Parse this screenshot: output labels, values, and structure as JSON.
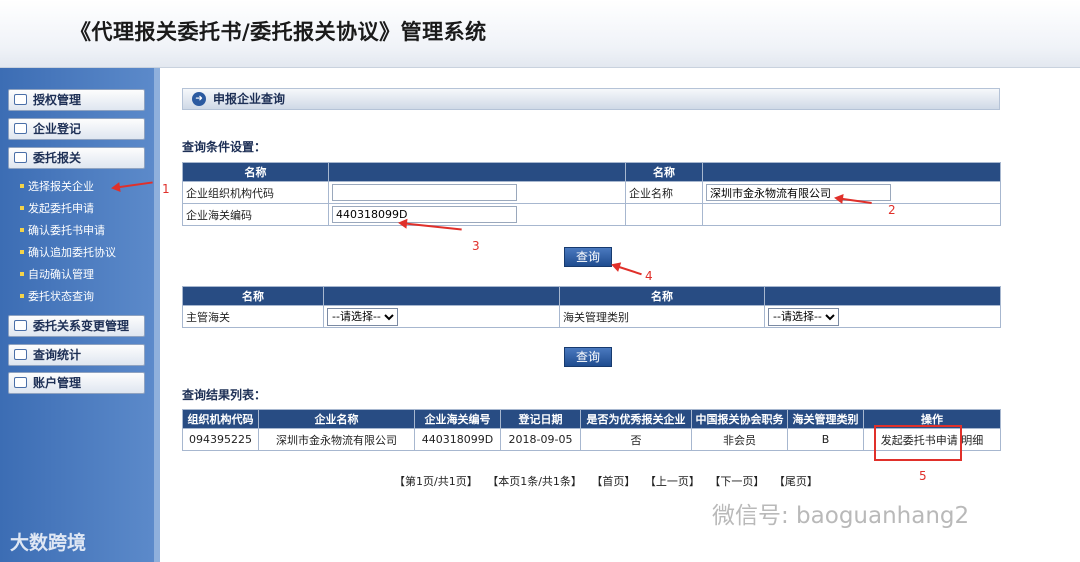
{
  "app_title": "《代理报关委托书/委托报关协议》管理系统",
  "sidebar": {
    "menus": [
      {
        "label": "授权管理"
      },
      {
        "label": "企业登记"
      },
      {
        "label": "委托报关"
      }
    ],
    "sub_items": [
      {
        "label": "选择报关企业"
      },
      {
        "label": "发起委托申请"
      },
      {
        "label": "确认委托书申请"
      },
      {
        "label": "确认追加委托协议"
      },
      {
        "label": "自动确认管理"
      },
      {
        "label": "委托状态查询"
      }
    ],
    "menus_after": [
      {
        "label": "委托关系变更管理"
      },
      {
        "label": "查询统计"
      },
      {
        "label": "账户管理"
      }
    ],
    "brand": "大数跨境"
  },
  "panel_title": "申报企业查询",
  "query_section": {
    "label": "查询条件设置：",
    "col_name": "名称",
    "fields": {
      "org_code_label": "企业组织机构代码",
      "org_code_value": "",
      "company_name_label": "企业名称",
      "company_name_value": "深圳市金永物流有限公司",
      "customs_code_label": "企业海关编码",
      "customs_code_value": "440318099D"
    },
    "query_button": "查询"
  },
  "filter_section": {
    "col_name": "名称",
    "customs_label": "主管海关",
    "customs_select": "--请选择--",
    "category_label": "海关管理类别",
    "category_select": "--请选择--",
    "query_button": "查询"
  },
  "results": {
    "label": "查询结果列表：",
    "headers": [
      "组织机构代码",
      "企业名称",
      "企业海关编号",
      "登记日期",
      "是否为优秀报关企业",
      "中国报关协会职务",
      "海关管理类别",
      "操作"
    ],
    "rows": [
      {
        "org_code": "094395225",
        "name": "深圳市金永物流有限公司",
        "customs_no": "440318099D",
        "date": "2018-09-05",
        "excellent": "否",
        "role": "非会员",
        "category": "B",
        "action_apply": "发起委托书申请",
        "action_detail": "明细"
      }
    ]
  },
  "pager": [
    "【第1页/共1页】",
    "【本页1条/共1条】",
    "【首页】",
    "【上一页】",
    "【下一页】",
    "【尾页】"
  ],
  "annotations": [
    "1",
    "2",
    "3",
    "4",
    "5"
  ],
  "watermark": "微信号: baoguanhang2",
  "colors": {
    "header_blue": "#284c83",
    "sidebar_blue": "#3c6db4",
    "annotation_red": "#e0302a"
  }
}
